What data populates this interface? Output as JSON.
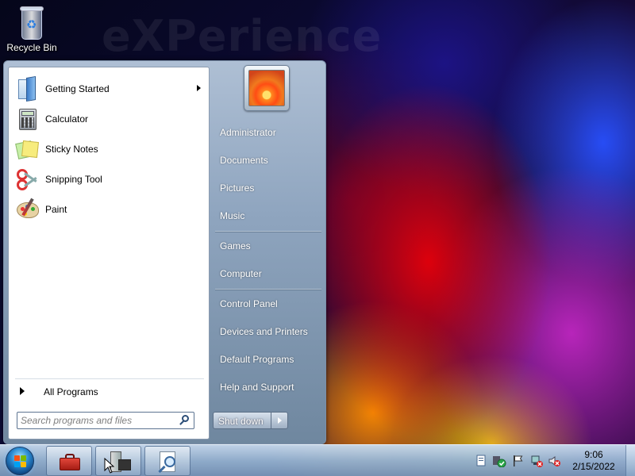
{
  "desktop": {
    "wallpaper_text": "eXPerience",
    "icons": [
      {
        "label": "Recycle Bin",
        "icon": "recycle-bin-icon"
      }
    ]
  },
  "start_menu": {
    "programs": [
      {
        "label": "Getting Started",
        "icon": "getting-started-icon",
        "has_submenu": true
      },
      {
        "label": "Calculator",
        "icon": "calculator-icon",
        "has_submenu": false
      },
      {
        "label": "Sticky Notes",
        "icon": "sticky-notes-icon",
        "has_submenu": false
      },
      {
        "label": "Snipping Tool",
        "icon": "snipping-tool-icon",
        "has_submenu": false
      },
      {
        "label": "Paint",
        "icon": "paint-icon",
        "has_submenu": false
      }
    ],
    "all_programs": "All Programs",
    "search": {
      "placeholder": "Search programs and files",
      "value": ""
    },
    "right_items": [
      {
        "label": "Administrator"
      },
      {
        "label": "Documents"
      },
      {
        "label": "Pictures"
      },
      {
        "label": "Music"
      },
      {
        "label": "Games"
      },
      {
        "label": "Computer"
      },
      {
        "label": "Control Panel"
      },
      {
        "label": "Devices and Printers"
      },
      {
        "label": "Default Programs"
      },
      {
        "label": "Help and Support"
      }
    ],
    "shutdown_label": "Shut down"
  },
  "taskbar": {
    "pinned": [
      {
        "icon": "toolbox-icon"
      },
      {
        "icon": "computer-management-icon"
      },
      {
        "icon": "magnifier-document-icon"
      }
    ],
    "tray_icons": [
      "action-center-icon",
      "security-shield-icon",
      "flag-icon",
      "network-icon",
      "volume-muted-icon"
    ],
    "clock": {
      "time": "9:06",
      "date": "2/15/2022"
    }
  }
}
